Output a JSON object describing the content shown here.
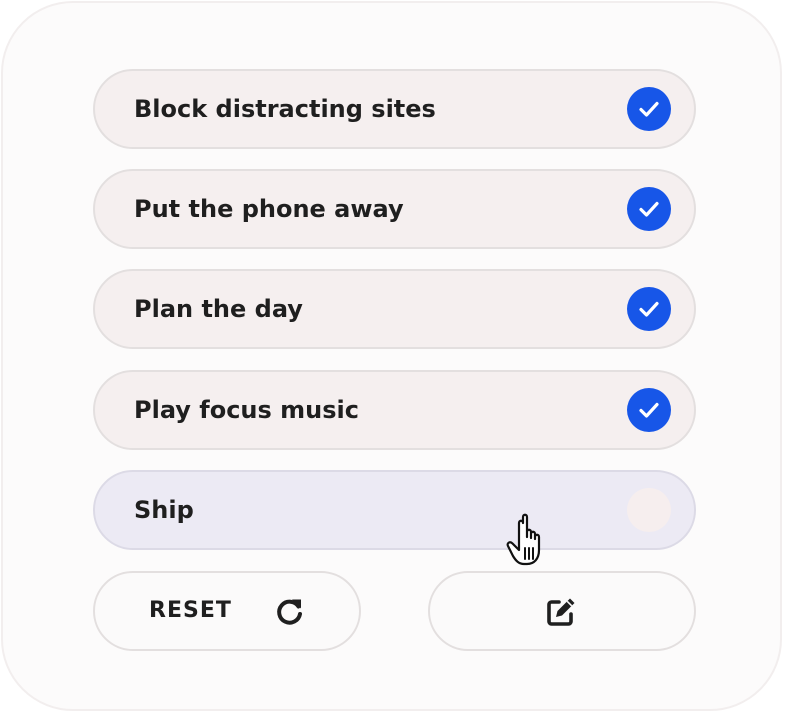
{
  "tasks": [
    {
      "label": "Block distracting sites",
      "checked": true
    },
    {
      "label": "Put the phone away",
      "checked": true
    },
    {
      "label": "Plan the day",
      "checked": true
    },
    {
      "label": "Play focus music",
      "checked": true
    },
    {
      "label": "Ship",
      "checked": false
    }
  ],
  "actions": {
    "reset_label": "RESET",
    "reset_icon": "refresh-icon",
    "edit_icon": "edit-icon"
  },
  "colors": {
    "check": "#1756e8",
    "task_bg": "#f5efef",
    "task_hover_bg": "#eceaf4",
    "text": "#1f1f1f"
  },
  "cursor": "hand-pointer-icon"
}
